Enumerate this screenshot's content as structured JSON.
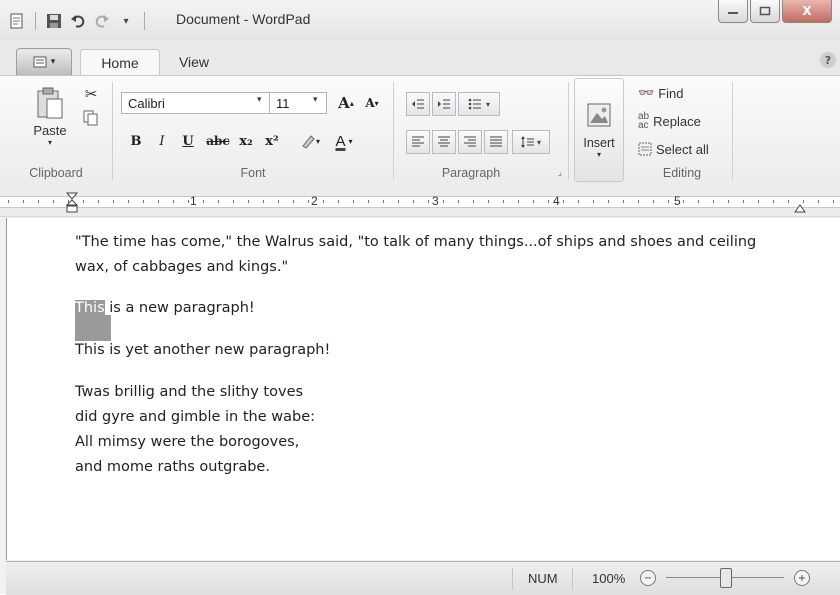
{
  "window": {
    "title": "Document - WordPad",
    "minimize_label": "–",
    "maximize_label": "□",
    "close_label": "X"
  },
  "qat": {
    "app_icon": "wordpad-doc-icon",
    "save_icon": "save-icon",
    "undo_icon": "undo-icon",
    "redo_icon": "redo-icon",
    "customize_icon": "dropdown-icon"
  },
  "tabs": {
    "home": "Home",
    "view": "View"
  },
  "ribbon": {
    "clipboard": {
      "label": "Clipboard",
      "paste": "Paste"
    },
    "font": {
      "label": "Font",
      "family": "Calibri",
      "size": "11",
      "grow": "A",
      "shrink": "A",
      "bold": "B",
      "italic": "I",
      "underline": "U",
      "strike": "abc",
      "subscript": "x₂",
      "superscript": "x²",
      "color_letter": "A"
    },
    "paragraph": {
      "label": "Paragraph"
    },
    "insert": {
      "label": "Insert"
    },
    "editing": {
      "label": "Editing",
      "find": "Find",
      "replace": "Replace",
      "select_all": "Select all"
    }
  },
  "ruler": {
    "numbers": [
      "1",
      "2",
      "3",
      "4",
      "5"
    ]
  },
  "document": {
    "para1_line1": "\"The time has come,\" the Walrus said, \"to talk of many things...of ships and shoes and ceiling",
    "para1_line2": "wax, of cabbages and kings.\"",
    "para2_selected": "This",
    "para2_rest": " is a new paragraph!",
    "para3": "This is yet another new paragraph!",
    "poem1": "Twas brillig and the slithy toves",
    "poem2": "did gyre and gimble in the wabe:",
    "poem3": " All mimsy were the borogoves,",
    "poem4": "and mome  raths outgrabe."
  },
  "status": {
    "num": "NUM",
    "zoom": "100%",
    "zoom_out": "−",
    "zoom_in": "+"
  }
}
